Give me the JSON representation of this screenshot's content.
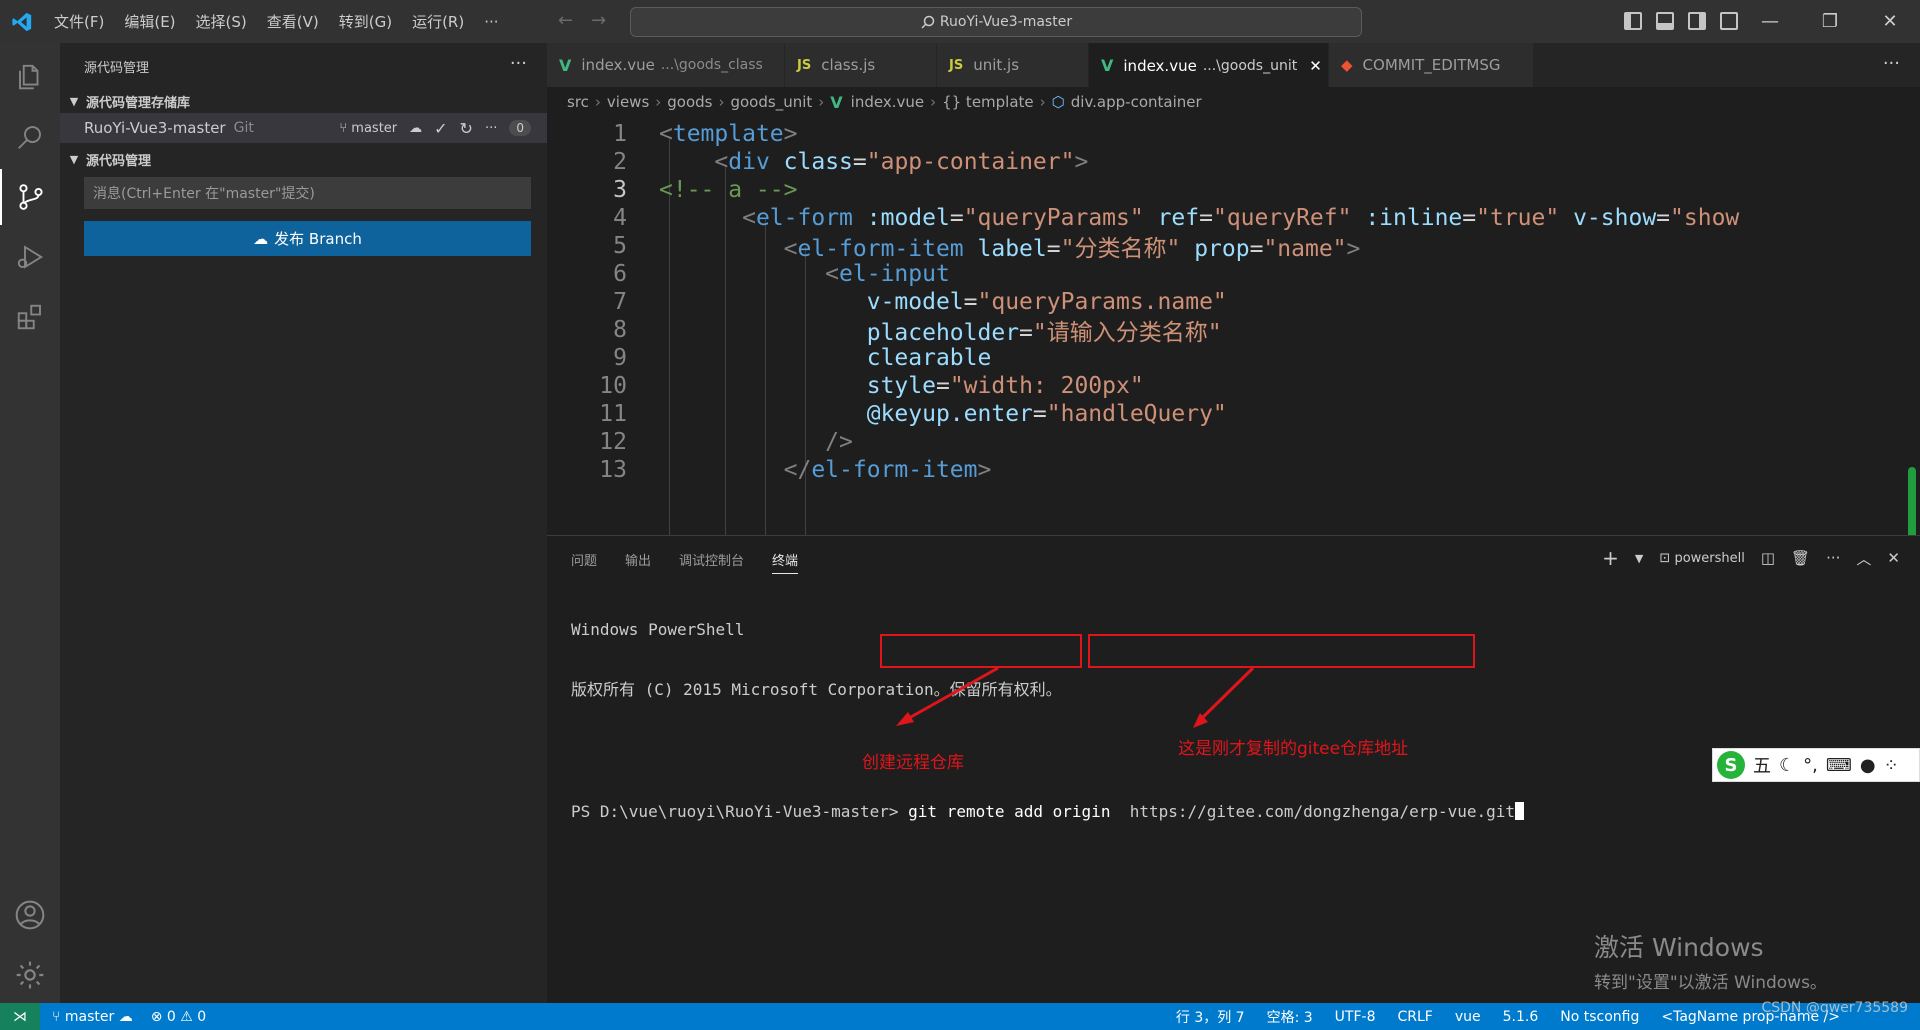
{
  "titlebar": {
    "menus": [
      "文件(F)",
      "编辑(E)",
      "选择(S)",
      "查看(V)",
      "转到(G)",
      "运行(R)",
      "···"
    ],
    "search_text": "RuoYi-Vue3-master"
  },
  "sidebar": {
    "title": "源代码管理",
    "section_repos": "源代码管理存储库",
    "repo_name": "RuoYi-Vue3-master",
    "repo_type": "Git",
    "branch": "master",
    "changes_count": "0",
    "section_scm": "源代码管理",
    "message_placeholder": "消息(Ctrl+Enter 在\"master\"提交)",
    "publish_label": "发布 Branch"
  },
  "tabs": [
    {
      "name": "index.vue",
      "desc": "...\\goods_class",
      "icon": "vue-icon"
    },
    {
      "name": "class.js",
      "desc": "",
      "icon": "js-icon"
    },
    {
      "name": "unit.js",
      "desc": "",
      "icon": "js-icon"
    },
    {
      "name": "index.vue",
      "desc": "...\\goods_unit",
      "icon": "vue-icon",
      "active": true
    },
    {
      "name": "COMMIT_EDITMSG",
      "desc": "",
      "icon": "git-icon"
    }
  ],
  "breadcrumb": [
    "src",
    "views",
    "goods",
    "goods_unit",
    "index.vue",
    "{} template",
    "div.app-container"
  ],
  "editor": {
    "current_line": 3,
    "line_numbers": [
      "1",
      "2",
      "3",
      "4",
      "5",
      "6",
      "7",
      "8",
      "9",
      "10",
      "11",
      "12",
      "13"
    ]
  },
  "panel": {
    "tabs": [
      "问题",
      "输出",
      "调试控制台",
      "终端"
    ],
    "active_tab": "终端",
    "shell": "powershell",
    "terminal_line1": "Windows PowerShell",
    "terminal_line2": "版权所有 (C) 2015 Microsoft Corporation。保留所有权利。",
    "prompt": "PS D:\\vue\\ruoyi\\RuoYi-Vue3-master>",
    "command": "git remote add origin",
    "url": "https://gitee.com/dongzhenga/erp-vue.git"
  },
  "annotations": {
    "note1": "创建远程仓库",
    "note2": "这是刚才复制的gitee仓库地址",
    "color": "#e0151b"
  },
  "ime": {
    "label": "五"
  },
  "activation": {
    "title": "激活 Windows",
    "subtitle": "转到\"设置\"以激活 Windows。"
  },
  "statusbar": {
    "branch": "master",
    "errors": "0",
    "warnings": "0",
    "position": "行 3，列 7",
    "spaces": "空格: 3",
    "encoding": "UTF-8",
    "eol": "CRLF",
    "language": "vue",
    "version": "5.1.6",
    "tsconfig": "No tsconfig",
    "tagname": "<TagName prop-name />"
  },
  "watermark": "CSDN @qwer735589",
  "colors": {
    "accent": "#007acc",
    "publish": "#0e639c",
    "remote": "#16825d"
  }
}
